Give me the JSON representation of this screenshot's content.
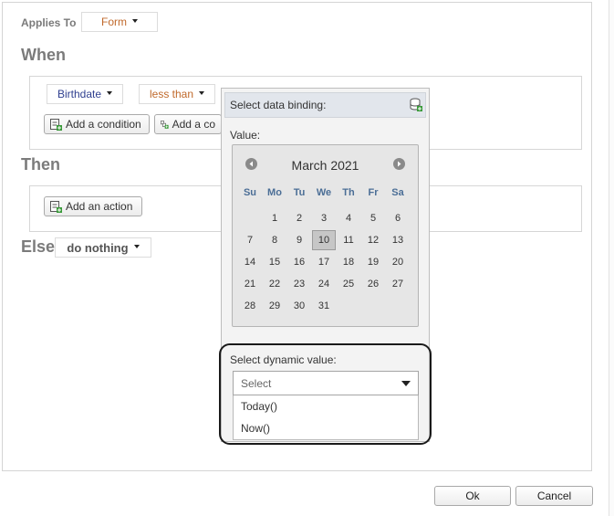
{
  "applies_to": {
    "label": "Applies To",
    "value": "Form"
  },
  "sections": {
    "when": "When",
    "then": "Then",
    "else": "Else"
  },
  "condition": {
    "field": "Birthdate",
    "operator": "less than"
  },
  "buttons": {
    "add_condition": "Add a condition",
    "add_group_truncated": "Add a co",
    "add_action": "Add an action",
    "ok": "Ok",
    "cancel": "Cancel"
  },
  "else_value": "do nothing",
  "popup": {
    "binding_label": "Select data binding:",
    "value_label": "Value:",
    "calendar": {
      "title": "March 2021",
      "weekdays": [
        "Su",
        "Mo",
        "Tu",
        "We",
        "Th",
        "Fr",
        "Sa"
      ],
      "weeks": [
        [
          "",
          "1",
          "2",
          "3",
          "4",
          "5",
          "6"
        ],
        [
          "7",
          "8",
          "9",
          "10",
          "11",
          "12",
          "13"
        ],
        [
          "14",
          "15",
          "16",
          "17",
          "18",
          "19",
          "20"
        ],
        [
          "21",
          "22",
          "23",
          "24",
          "25",
          "26",
          "27"
        ],
        [
          "28",
          "29",
          "30",
          "31",
          "",
          "",
          ""
        ]
      ],
      "selected_day": "10"
    },
    "dynamic": {
      "label": "Select dynamic value:",
      "placeholder": "Select",
      "options": [
        "Today()",
        "Now()"
      ]
    }
  },
  "colors": {
    "accent_orange": "#c0692b",
    "link_blue": "#2f3f8f",
    "weekday_blue": "#4b6e96",
    "highlight_ring": "#1a1a1a"
  }
}
